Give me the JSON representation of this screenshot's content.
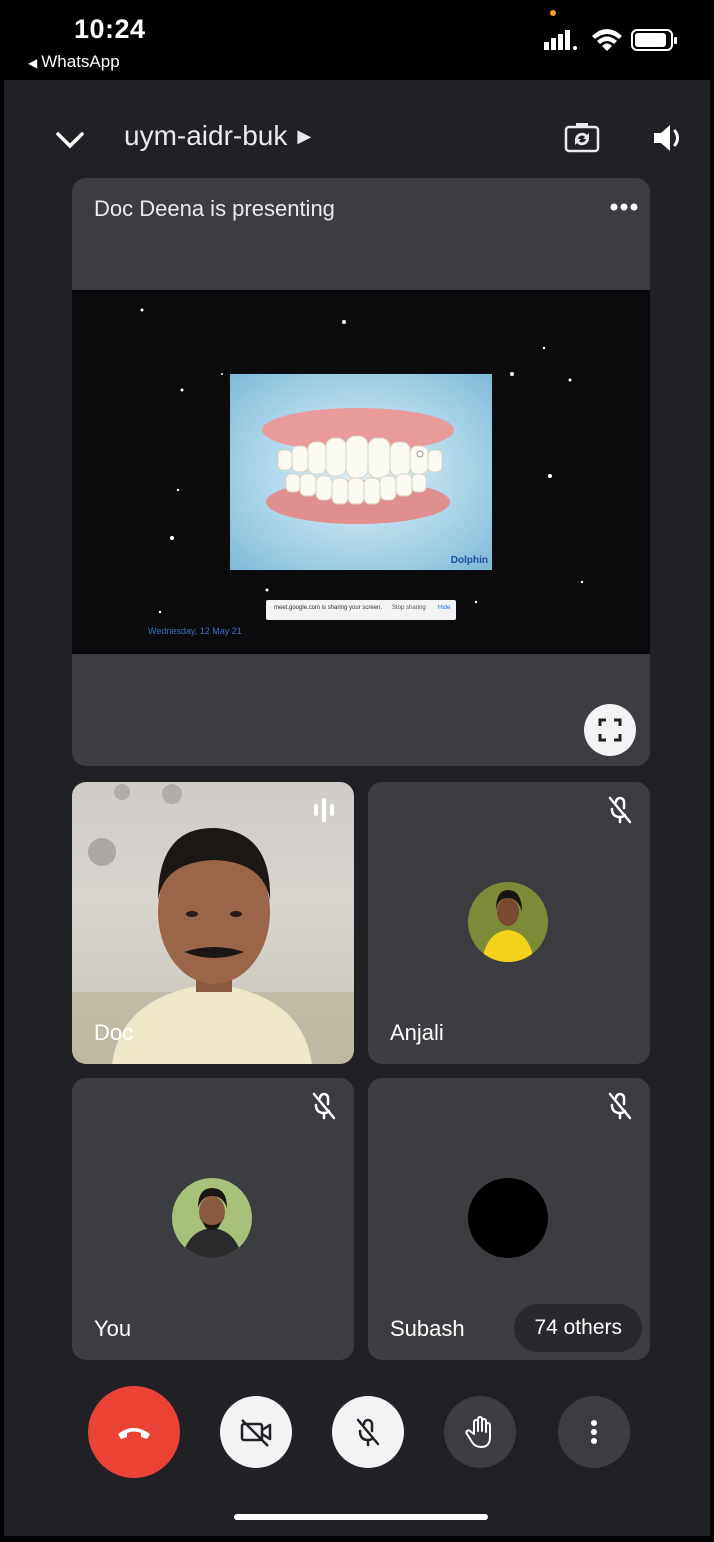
{
  "status_bar": {
    "time": "10:24",
    "back_app": "WhatsApp"
  },
  "header": {
    "meeting_code": "uym-aidr-buk",
    "chevron_icon": "chevron-down-icon",
    "camera_flip_icon": "camera-flip-icon",
    "speaker_icon": "speaker-icon"
  },
  "presentation": {
    "title": "Doc Deena is presenting",
    "slide_logo": "Dolphin",
    "share_bar_text": "meet.google.com is sharing your screen.",
    "share_bar_stop": "Stop sharing",
    "share_bar_hide": "Hide",
    "date_text": "Wednesday, 12 May 21"
  },
  "participants": [
    {
      "name": "Doc",
      "state": "speaking"
    },
    {
      "name": "Anjali",
      "state": "muted"
    },
    {
      "name": "You",
      "state": "muted"
    },
    {
      "name": "Subash",
      "state": "muted"
    }
  ],
  "others_chip": "74 others",
  "controls": [
    "end-call",
    "camera-off",
    "mic-off",
    "raise-hand",
    "more-options"
  ],
  "colors": {
    "background": "#202124",
    "tile": "#3c3d40",
    "end_call": "#ea4335",
    "button_light": "#f1f3f4"
  }
}
